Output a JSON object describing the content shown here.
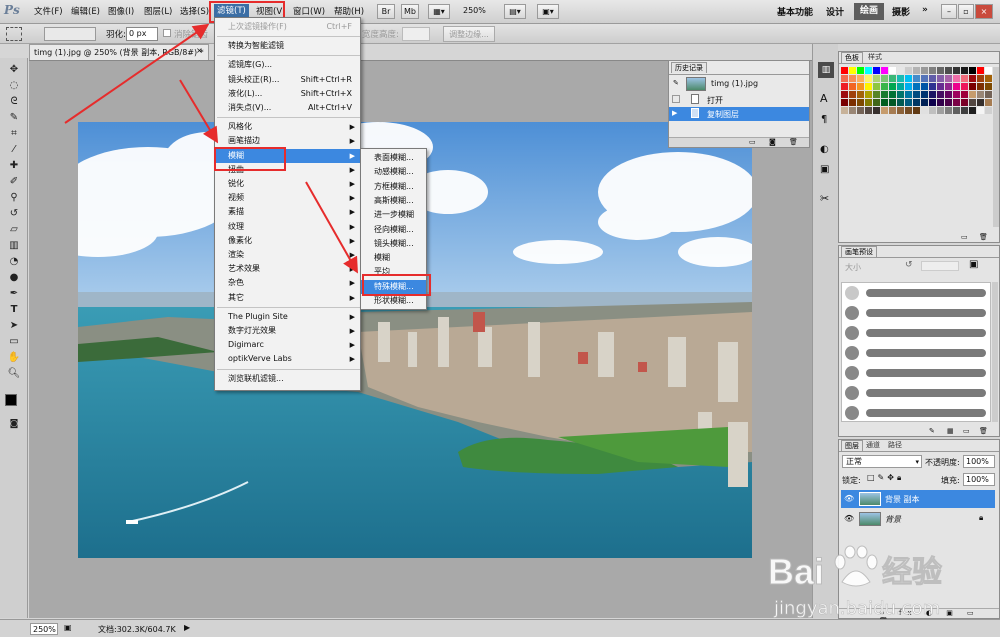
{
  "app": {
    "logo": "Ps"
  },
  "menubar": {
    "items": [
      "文件(F)",
      "编辑(E)",
      "图像(I)",
      "图层(L)",
      "选择(S)",
      "滤镜(T)",
      "视图(V)",
      "窗口(W)",
      "帮助(H)"
    ],
    "zoom": "250%",
    "workspaces": [
      "基本功能",
      "设计",
      "绘画",
      "摄影"
    ],
    "more": "»"
  },
  "options": {
    "feather_label": "羽化:",
    "feather_value": "0 px",
    "antialias_label": "消除锯齿",
    "width_label": "宽度",
    "height_label": "高度:",
    "refine_button": "调整边缘..."
  },
  "document": {
    "tab_title": "timg (1).jpg @ 250% (背景 副本, RGB/8#) *",
    "close": "×"
  },
  "history": {
    "tabs": [
      "历史记录"
    ],
    "snapshot_name": "timg (1).jpg",
    "steps": [
      "打开",
      "复制图层"
    ]
  },
  "swatches": {
    "tabs": [
      "色板",
      "样式"
    ]
  },
  "brushes": {
    "tabs": [
      "画笔预设"
    ],
    "size_label": "大小"
  },
  "layers": {
    "tabs": [
      "图层",
      "通道",
      "路径"
    ],
    "blend_mode": "正常",
    "opacity_label": "不透明度:",
    "opacity_value": "100%",
    "lock_label": "锁定:",
    "fill_label": "填充:",
    "fill_value": "100%",
    "items": [
      {
        "name": "背景 副本"
      },
      {
        "name": "背景"
      }
    ]
  },
  "statusbar": {
    "zoom": "250%",
    "doc_info": "文档:302.3K/604.7K"
  },
  "filter_menu": {
    "items": [
      {
        "label": "上次滤镜操作(F)",
        "shortcut": "Ctrl+F",
        "disabled": true
      },
      {
        "sep": true
      },
      {
        "label": "转换为智能滤镜"
      },
      {
        "sep": true
      },
      {
        "label": "滤镜库(G)..."
      },
      {
        "label": "镜头校正(R)...",
        "shortcut": "Shift+Ctrl+R"
      },
      {
        "label": "液化(L)...",
        "shortcut": "Shift+Ctrl+X"
      },
      {
        "label": "消失点(V)...",
        "shortcut": "Alt+Ctrl+V"
      },
      {
        "sep": true
      },
      {
        "label": "风格化",
        "sub": true
      },
      {
        "label": "画笔描边",
        "sub": true
      },
      {
        "label": "模糊",
        "sub": true,
        "highlight": true
      },
      {
        "label": "扭曲",
        "sub": true
      },
      {
        "label": "锐化",
        "sub": true
      },
      {
        "label": "视频",
        "sub": true
      },
      {
        "label": "素描",
        "sub": true
      },
      {
        "label": "纹理",
        "sub": true
      },
      {
        "label": "像素化",
        "sub": true
      },
      {
        "label": "渲染",
        "sub": true
      },
      {
        "label": "艺术效果",
        "sub": true
      },
      {
        "label": "杂色",
        "sub": true
      },
      {
        "label": "其它",
        "sub": true
      },
      {
        "sep": true
      },
      {
        "label": "The Plugin Site",
        "sub": true
      },
      {
        "label": "数字灯光效果",
        "sub": true
      },
      {
        "label": "Digimarc",
        "sub": true
      },
      {
        "label": "optikVerve Labs",
        "sub": true
      },
      {
        "sep": true
      },
      {
        "label": "浏览联机滤镜..."
      }
    ]
  },
  "blur_submenu": {
    "items": [
      {
        "label": "表面模糊..."
      },
      {
        "label": "动感模糊..."
      },
      {
        "label": "方框模糊..."
      },
      {
        "label": "高斯模糊..."
      },
      {
        "label": "进一步模糊"
      },
      {
        "label": "径向模糊..."
      },
      {
        "label": "镜头模糊..."
      },
      {
        "label": "模糊"
      },
      {
        "label": "平均"
      },
      {
        "label": "特殊模糊...",
        "highlight": true
      },
      {
        "label": "形状模糊..."
      }
    ]
  },
  "watermark": {
    "brand": "Bai",
    "brand_cn": "经验",
    "url": "jingyan.baidu.com"
  },
  "colors": {
    "accent": "#3c88e0",
    "annotation": "#e62c2c"
  }
}
